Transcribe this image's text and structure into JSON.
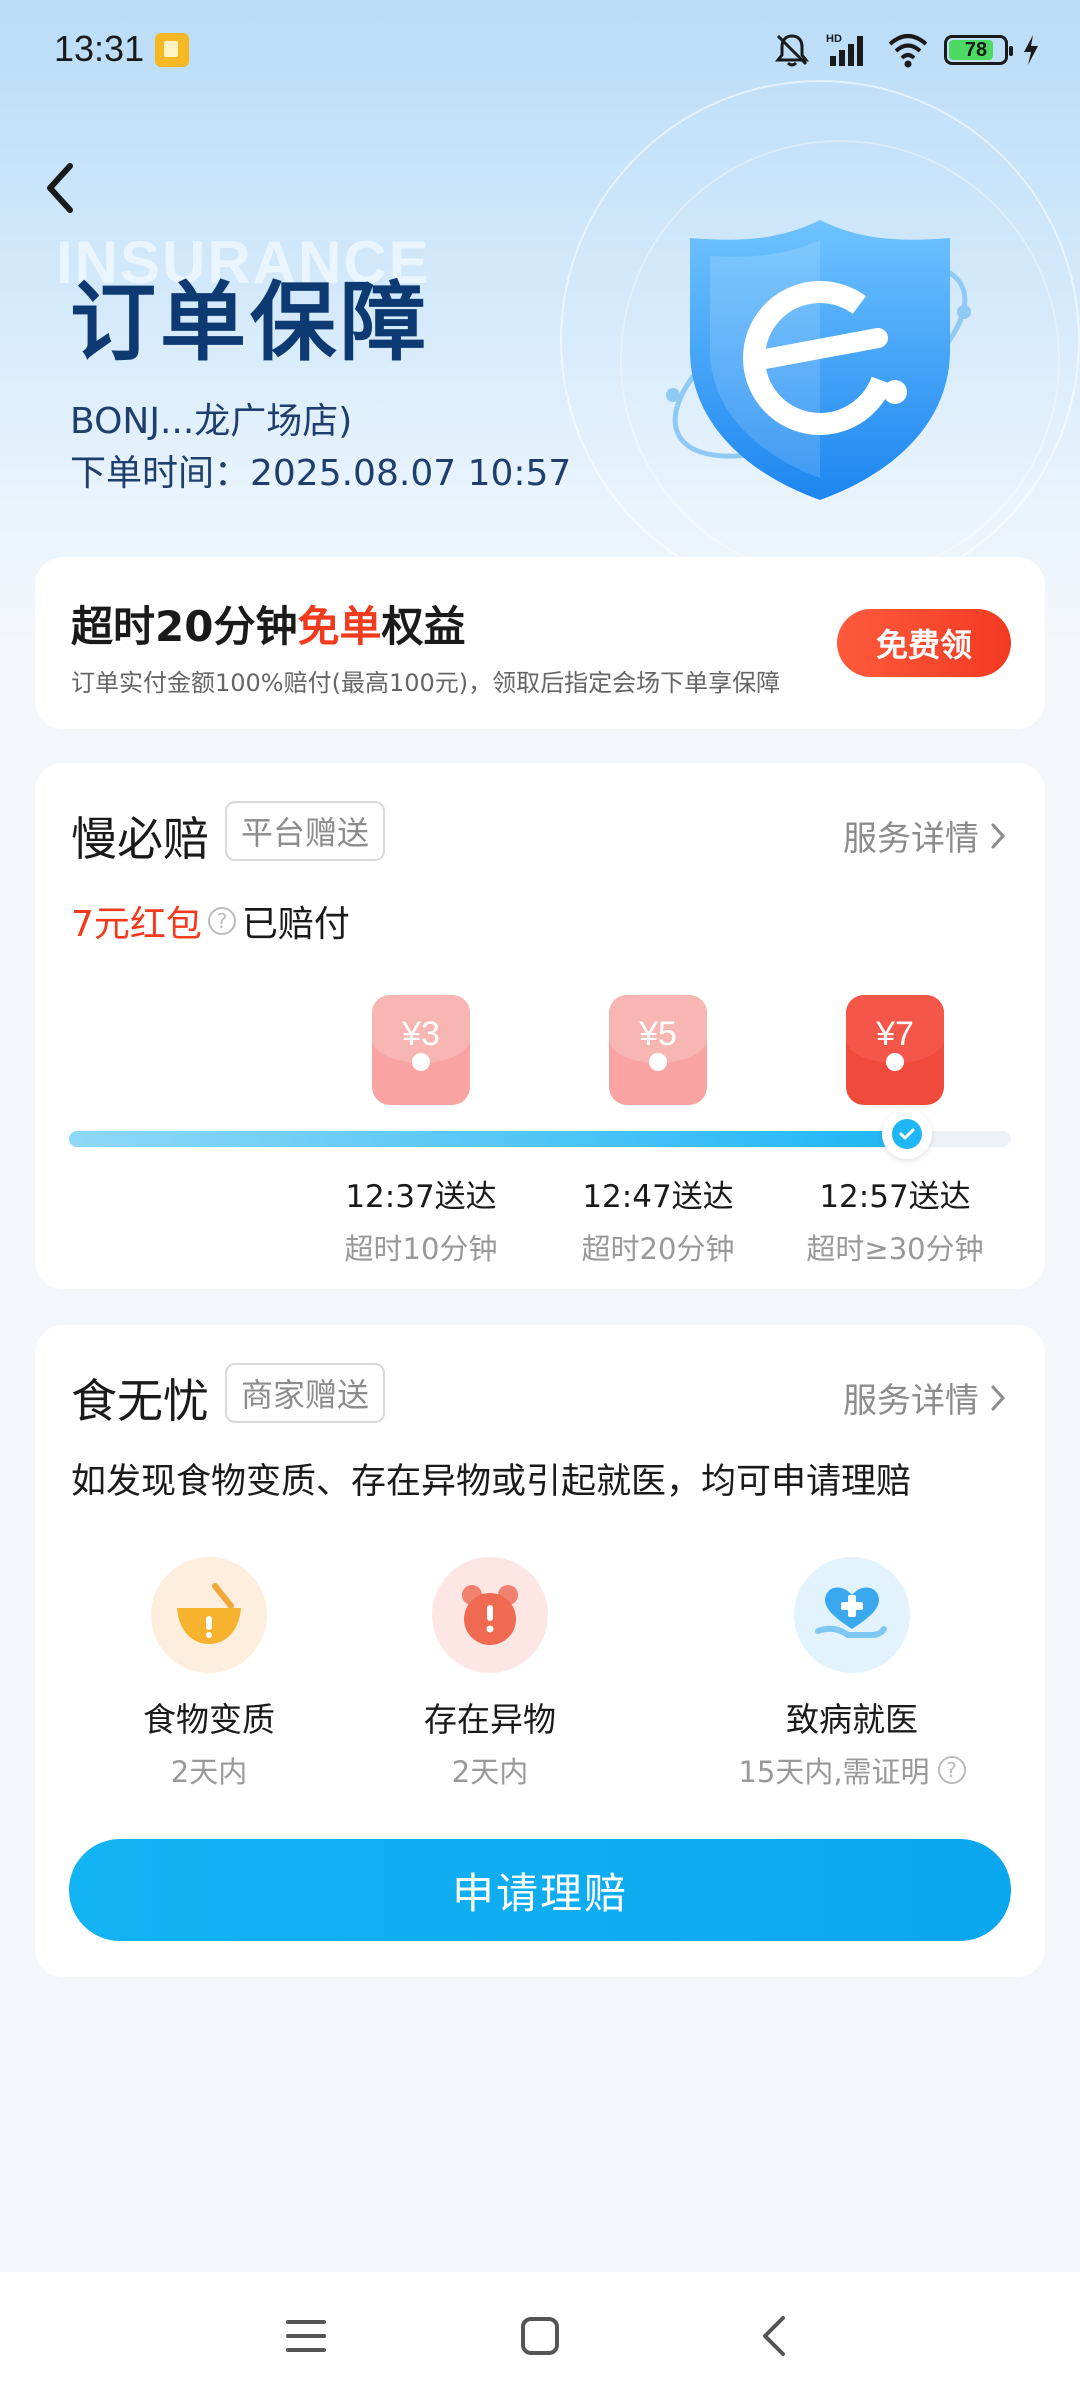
{
  "status_bar": {
    "time": "13:31",
    "battery": "78",
    "icons": [
      "mute-icon",
      "hd-signal-icon",
      "wifi-icon",
      "battery-icon",
      "charging-icon"
    ]
  },
  "header": {
    "watermark": "INSURANCE",
    "title": "订单保障",
    "store": "BONJ...龙广场店)",
    "order_time": "下单时间：2025.08.07 10:57"
  },
  "promo": {
    "title_prefix": "超时20分钟",
    "title_highlight": "免单",
    "title_suffix": "权益",
    "description": "订单实付金额100%赔付(最高100元)，领取后指定会场下单享保障",
    "button": "免费领"
  },
  "slow_pay": {
    "title": "慢必赔",
    "tag": "平台赠送",
    "detail": "服务详情",
    "paid_amount": "7元红包",
    "paid_status": "已赔付",
    "progress": 0.89,
    "milestones": [
      {
        "amount": "¥3",
        "time": "12:37送达",
        "condition": "超时10分钟"
      },
      {
        "amount": "¥5",
        "time": "12:47送达",
        "condition": "超时20分钟"
      },
      {
        "amount": "¥7",
        "time": "12:57送达",
        "condition": "超时≥30分钟"
      }
    ]
  },
  "food_safety": {
    "title": "食无忧",
    "tag": "商家赠送",
    "detail": "服务详情",
    "description": "如发现食物变质、存在异物或引起就医，均可申请理赔",
    "items": [
      {
        "label": "食物变质",
        "sub": "2天内",
        "icon": "spoiled-bowl-icon"
      },
      {
        "label": "存在异物",
        "sub": "2天内",
        "icon": "alarm-clock-icon"
      },
      {
        "label": "致病就医",
        "sub": "15天内,需证明",
        "icon": "medical-heart-icon"
      }
    ],
    "claim_button": "申请理赔"
  },
  "colors": {
    "accent_blue": "#12b3f3",
    "highlight_red": "#f23b1e",
    "title_navy": "#0e3a73"
  }
}
